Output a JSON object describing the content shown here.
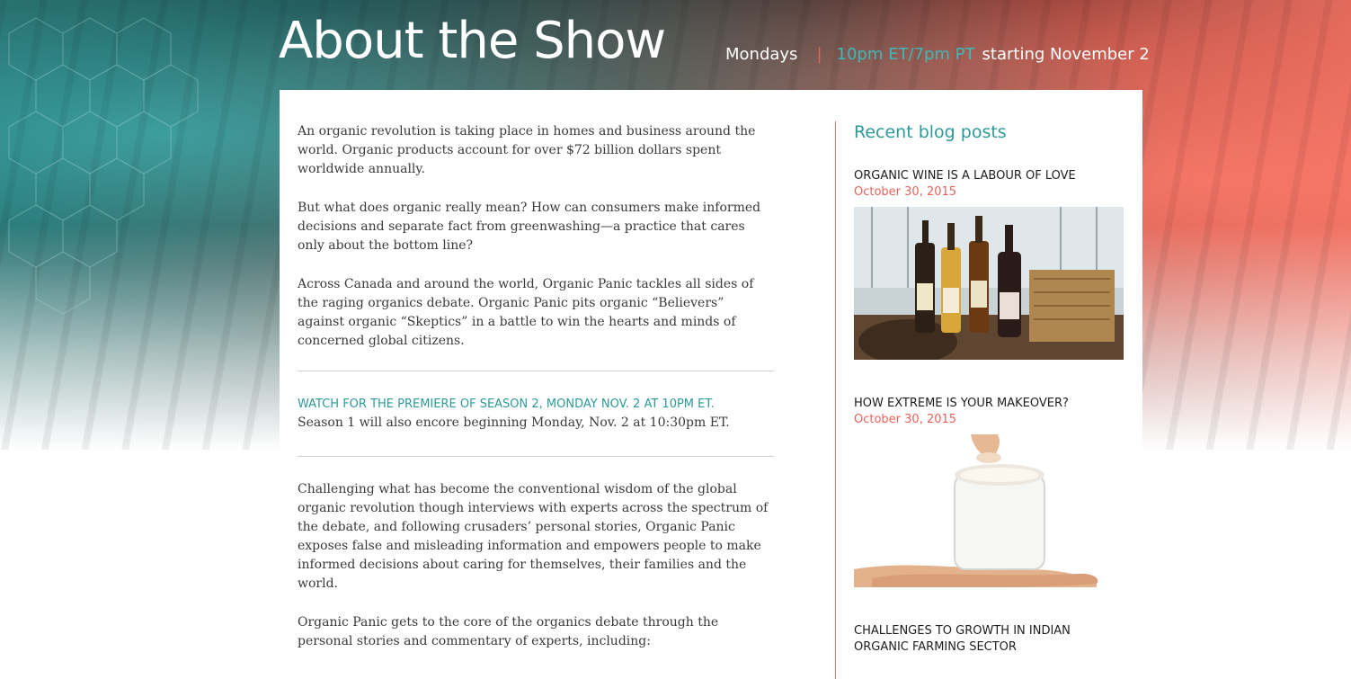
{
  "header": {
    "title": "About the Show",
    "schedule": {
      "day": "Mondays",
      "separator": "|",
      "time": "10pm ET/7pm PT",
      "start": "starting November 2"
    }
  },
  "main": {
    "intro_paragraphs": [
      "An organic revolution is taking place in homes and business around the world. Organic products account for over $72 billion dollars spent worldwide annually.",
      "But what does organic really mean? How can consumers make informed decisions and separate fact from greenwashing—a practice that cares only about the bottom line?",
      "Across Canada and around the world, Organic Panic tackles all sides of the raging organics debate. Organic Panic pits organic “Believers” against organic “Skeptics” in a battle to win the hearts and minds of concerned global citizens."
    ],
    "premiere": {
      "headline": "WATCH FOR THE PREMIERE OF SEASON 2, MONDAY NOV. 2 AT 10PM ET.",
      "encore": "Season 1 will also encore beginning Monday, Nov. 2 at 10:30pm ET."
    },
    "body_paragraphs": [
      "Challenging what has become the conventional wisdom of the global organic revolution though interviews with experts across the spectrum of the debate, and following crusaders’ personal stories, Organic Panic exposes false and misleading information and empowers people to make informed decisions about caring for themselves, their families and the world.",
      "Organic Panic gets to the core of the organics debate through the personal stories and commentary of experts, including:"
    ]
  },
  "sidebar": {
    "heading": "Recent blog posts",
    "posts": [
      {
        "title": "ORGANIC WINE IS A LABOUR OF LOVE",
        "date": "October 30, 2015",
        "image": "wine-bottles-image"
      },
      {
        "title": "HOW EXTREME IS YOUR MAKEOVER?",
        "date": "October 30, 2015",
        "image": "cream-jar-image"
      },
      {
        "title": "CHALLENGES TO GROWTH IN INDIAN ORGANIC FARMING SECTOR",
        "date": "",
        "image": ""
      }
    ]
  },
  "colors": {
    "teal_accent": "#2e9a98",
    "coral_accent": "#e8645a",
    "body_text": "#3a3a3a"
  }
}
